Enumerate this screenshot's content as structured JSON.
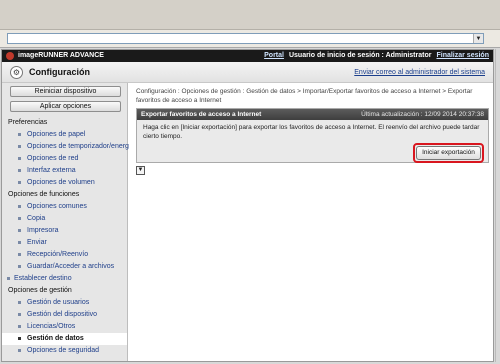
{
  "browser": {
    "address_dropdown_icon": "chevron-down-icon"
  },
  "brand": {
    "name": "imageRUNNER ADVANCE",
    "portal": "Portal",
    "login_label": "Usuario de inicio de sesión : Administrator",
    "logout": "Finalizar sesión",
    "logo_color": "#c0392b"
  },
  "header": {
    "title": "Configuración",
    "title_icon": "gear-icon",
    "send_email": "Enviar correo al administrador del sistema"
  },
  "sidebar": {
    "restart_button": "Reiniciar dispositivo",
    "apply_button": "Aplicar opciones",
    "items": [
      {
        "label": "Preferencias",
        "kind": "head"
      },
      {
        "label": "Opciones de papel",
        "kind": "sub"
      },
      {
        "label": "Opciones de temporizador/energía",
        "kind": "sub"
      },
      {
        "label": "Opciones de red",
        "kind": "sub"
      },
      {
        "label": "Interfaz externa",
        "kind": "sub"
      },
      {
        "label": "Opciones de volumen",
        "kind": "sub"
      },
      {
        "label": "Opciones de funciones",
        "kind": "head"
      },
      {
        "label": "Opciones comunes",
        "kind": "sub"
      },
      {
        "label": "Copia",
        "kind": "sub"
      },
      {
        "label": "Impresora",
        "kind": "sub"
      },
      {
        "label": "Enviar",
        "kind": "sub"
      },
      {
        "label": "Recepción/Reenvío",
        "kind": "sub"
      },
      {
        "label": "Guardar/Acceder a archivos",
        "kind": "sub"
      },
      {
        "label": "Establecer destino",
        "kind": "bullet"
      },
      {
        "label": "Opciones de gestión",
        "kind": "head"
      },
      {
        "label": "Gestión de usuarios",
        "kind": "sub"
      },
      {
        "label": "Gestión del dispositivo",
        "kind": "sub"
      },
      {
        "label": "Licencias/Otros",
        "kind": "sub"
      },
      {
        "label": "Gestión de datos",
        "kind": "sub",
        "active": true
      },
      {
        "label": "Opciones de seguridad",
        "kind": "sub"
      }
    ]
  },
  "content": {
    "breadcrumb": "Configuración : Opciones de gestión : Gestión de datos > Importar/Exportar favoritos de acceso a Internet > Exportar favoritos de acceso a Internet",
    "panel_title": "Exportar favoritos de acceso a Internet",
    "last_update": "Última actualización : 12/09 2014 20:37:38",
    "body_text": "Haga clic en [Iniciar exportación] para exportar los favoritos de acceso a Internet. El reenvío del archivo puede tardar cierto tiempo.",
    "start_button": "Iniciar exportación",
    "highlight_color": "#d9161f",
    "bottom_icon": "page-bottom-icon"
  }
}
